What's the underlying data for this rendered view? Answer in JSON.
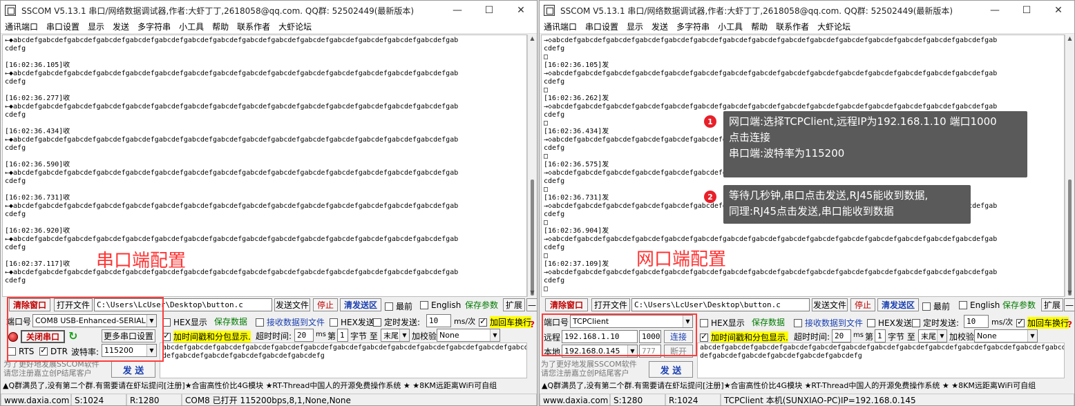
{
  "left": {
    "title": "SSCOM V5.13.1 串口/网络数据调试器,作者:大虾丁丁,2618058@qq.com. QQ群:  52502449(最新版本)",
    "menu": [
      "通讯端口",
      "串口设置",
      "显示",
      "发送",
      "多字符串",
      "小工具",
      "帮助",
      "联系作者",
      "大虾论坛"
    ],
    "recv_lines": [
      "←◆abcdefgabcdefgabcdefgabcdefgabcdefgabcdefgabcdefgabcdefgabcdefgabcdefgabcdefgabcdefgabcdefgabcdefgabcdefgab",
      "cdefg",
      "",
      "[16:02:36.105]收",
      "←◆abcdefgabcdefgabcdefgabcdefgabcdefgabcdefgabcdefgabcdefgabcdefgabcdefgabcdefgabcdefgabcdefgabcdefgabcdefgab",
      "cdefg",
      "",
      "[16:02:36.277]收",
      "←◆abcdefgabcdefgabcdefgabcdefgabcdefgabcdefgabcdefgabcdefgabcdefgabcdefgabcdefgabcdefgabcdefgabcdefgabcdefgab",
      "cdefg",
      "",
      "[16:02:36.434]收",
      "←◆abcdefgabcdefgabcdefgabcdefgabcdefgabcdefgabcdefgabcdefgabcdefgabcdefgabcdefgabcdefgabcdefgabcdefgabcdefgab",
      "cdefg",
      "",
      "[16:02:36.590]收",
      "←◆abcdefgabcdefgabcdefgabcdefgabcdefgabcdefgabcdefgabcdefgabcdefgabcdefgabcdefgabcdefgabcdefgabcdefgabcdefgab",
      "cdefg",
      "",
      "[16:02:36.731]收",
      "←◆abcdefgabcdefgabcdefgabcdefgabcdefgabcdefgabcdefgabcdefgabcdefgabcdefgabcdefgabcdefgabcdefgabcdefgabcdefgab",
      "cdefg",
      "",
      "[16:02:36.920]收",
      "←◆abcdefgabcdefgabcdefgabcdefgabcdefgabcdefgabcdefgabcdefgabcdefgabcdefgabcdefgabcdefgabcdefgabcdefgabcdefgab",
      "cdefg",
      "",
      "[16:02:37.117]收",
      "←◆abcdefgabcdefgabcdefgabcdefgabcdefgabcdefgabcdefgabcdefgabcdefgabcdefgabcdefgabcdefgabcdefgabcdefgabcdefgab",
      "cdefg"
    ],
    "overlay_label": "串口端配置",
    "clear_btn": "清除窗口",
    "open_file_btn": "打开文件",
    "file_path": "C:\\Users\\LcUser\\Desktop\\button.c",
    "send_file_btn": "发送文件",
    "stop_btn": "停止",
    "clear_send_btn": "清发送区",
    "topmost_label": "最前",
    "english_label": "English",
    "save_params_btn": "保存参数",
    "expand_btn": "扩展",
    "collapse_btn": "—",
    "port_label": "端口号",
    "port_value": "COM8 USB-Enhanced-SERIAL C",
    "hex_display_label": "HEX显示",
    "save_data_btn": "保存数据",
    "recv_to_file_label": "接收数据到文件",
    "hex_send_label": "HEX发送",
    "timed_send_label": "定时发送:",
    "timed_interval": "10",
    "interval_unit": "ms/次",
    "add_crlf_label": "加回车换行",
    "close_port_btn": "关闭串口",
    "more_settings_btn": "更多串口设置",
    "timestamp_label": "加时间戳和分包显示.",
    "timeout_label": "超时时间:",
    "timeout_value": "20",
    "ms_label": "ms",
    "nth_label": "第",
    "byte_start": "1",
    "byte_label": "字节 至",
    "byte_end": "末尾",
    "checksum_label": "加校验",
    "checksum_value": "None",
    "rts_label": "RTS",
    "dtr_label": "DTR",
    "baud_label": "波特率:",
    "baud_value": "115200",
    "send_text": "abcdefgabcdefgabcdefgabcdefgabcdefgabcdefgabcdefgabcdefgabcdefgabcdefgabcdefgabcdefgabcdefgabcdefgabcdefgabc\ndefgabcdefgabcdefgabcdefgabcdefgabcdefg",
    "promo_line1": "为了更好地发展SSCOM软件",
    "promo_line2": "请您注册嘉立创P结尾客户",
    "send_btn": "发 送",
    "ticker": "▲Q群满员了,没有第二个群.有需要请在虾坛提问[注册]★合宙高性价比4G模块 ★RT-Thread中国人的开源免费操作系统 ★ ★8KM远距离WiFi可自组",
    "status": [
      "www.daxia.com",
      "S:1024",
      "R:1280",
      "COM8 已打开  115200bps,8,1,None,None"
    ]
  },
  "right": {
    "title": "SSCOM V5.13.1 串口/网络数据调试器,作者:大虾丁丁,2618058@qq.com. QQ群:  52502449(最新版本)",
    "menu": [
      "通讯端口",
      "串口设置",
      "显示",
      "发送",
      "多字符串",
      "小工具",
      "帮助",
      "联系作者",
      "大虾论坛"
    ],
    "recv_lines": [
      "→◇abcdefgabcdefgabcdefgabcdefgabcdefgabcdefgabcdefgabcdefgabcdefgabcdefgabcdefgabcdefgabcdefgabcdefgabcdefgab",
      "cdefg",
      "□",
      "[16:02:36.105]发",
      "→◇abcdefgabcdefgabcdefgabcdefgabcdefgabcdefgabcdefgabcdefgabcdefgabcdefgabcdefgabcdefgabcdefgabcdefgabcdefgab",
      "cdefg",
      "□",
      "[16:02:36.262]发",
      "→◇abcdefgabcdefgabcdefgabcdefgabcdefgabcdefgabcdefgabcdefgabcdefgabcdefgabcdefgabcdefgabcdefgabcdefgabcdefgab",
      "cdefg",
      "□",
      "[16:02:36.434]发",
      "→◇abcdefgabcdefgabcdefgabcdefgabcdefgabcdefgabcdefgabcdefgabcdefgabcdefgabcdefgabcdefgabcdefgabcdefgabcdefgab",
      "cdefg",
      "□",
      "[16:02:36.575]发",
      "→◇abcdefgabcdefgabcdefgabcdefgabcdefgabcdefgabcdefgabcdefgabcdefgabcdefgabcdefgabcdefgabcdefgabcdefgabcdefgab",
      "cdefg",
      "□",
      "[16:02:36.731]发",
      "→◇abcdefgabcdefgabcdefgabcdefgabcdefgabcdefgabcdefgabcdefgabcdefgabcdefgabcdefgabcdefgabcdefgabcdefgabcdefgab",
      "cdefg",
      "□",
      "[16:02:36.904]发",
      "→◇abcdefgabcdefgabcdefgabcdefgabcdefgabcdefgabcdefgabcdefgabcdefgabcdefgabcdefgabcdefgabcdefgabcdefgabcdefgab",
      "cdefg",
      "□",
      "[16:02:37.109]发",
      "→◇abcdefgabcdefgabcdefgabcdefgabcdefgabcdefgabcdefgabcdefgabcdefgabcdefgabcdefgabcdefgabcdefgabcdefgabcdefgab",
      "cdefg",
      "□"
    ],
    "overlay_label": "网口端配置",
    "callout1_num": "1",
    "callout1_line1": "网口端:选择TCPClient,远程IP为192.168.1.10 端口1000",
    "callout1_line2": "点击连接",
    "callout1_line3": "串口端:波特率为115200",
    "callout2_num": "2",
    "callout2_line1": "等待几秒钟,串口点击发送,RJ45能收到数据,",
    "callout2_line2": "同理:RJ45点击发送,串口能收到数据",
    "clear_btn": "清除窗口",
    "open_file_btn": "打开文件",
    "file_path": "C:\\Users\\LcUser\\Desktop\\button.c",
    "send_file_btn": "发送文件",
    "stop_btn": "停止",
    "clear_send_btn": "清发送区",
    "topmost_label": "最前",
    "english_label": "English",
    "save_params_btn": "保存参数",
    "expand_btn": "扩展",
    "collapse_btn": "—",
    "port_label": "端口号",
    "port_value": "TCPClient",
    "hex_display_label": "HEX显示",
    "save_data_btn": "保存数据",
    "recv_to_file_label": "接收数据到文件",
    "hex_send_label": "HEX发送",
    "timed_send_label": "定时发送:",
    "timed_interval": "10",
    "interval_unit": "ms/次",
    "add_crlf_label": "加回车换行",
    "remote_label": "远程",
    "remote_ip": "192.168.1.10",
    "remote_port": "1000",
    "connect_btn": "连接",
    "timestamp_label": "加时间戳和分包显示.",
    "timeout_label": "超时时间:",
    "timeout_value": "20",
    "ms_label": "ms",
    "nth_label": "第",
    "byte_start": "1",
    "byte_label": "字节 至",
    "byte_end": "末尾",
    "checksum_label": "加校验",
    "checksum_value": "None",
    "local_label": "本地",
    "local_ip": "192.168.0.145",
    "local_port": "777",
    "disconnect_btn": "断开",
    "send_text": "abcdefgabcdefgabcdefgabcdefgabcdefgabcdefgabcdefgabcdefgabcdefgabcdefgabcdefgabcdefgabcdefgabcdefgabcdefgabc\ndefgabcdefgabcdefgabcdefgabcdefgabcdefg",
    "promo_line1": "为了更好地发展SSCOM软件",
    "promo_line2": "请您注册嘉立创P结尾客户",
    "send_btn": "发 送",
    "ticker": "▲Q群满员了,没有第二个群.有需要请在虾坛提问[注册]★合宙高性价比4G模块 ★RT-Thread中国人的开源免费操作系统 ★ ★8KM远距离WiFi可自组",
    "status": [
      "www.daxia.com",
      "S:1280",
      "R:1024",
      "TCPClient 本机(SUNXIAO-PC)IP=192.168.0.145"
    ]
  }
}
